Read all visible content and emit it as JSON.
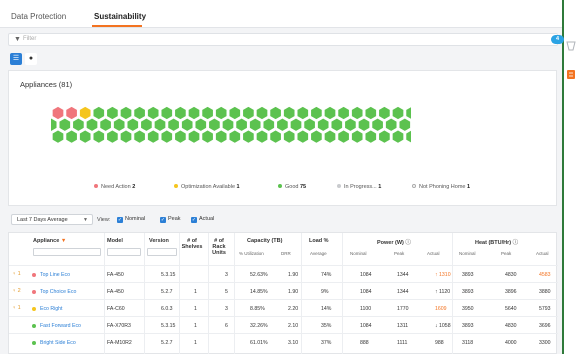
{
  "tabs": [
    {
      "label": "Data Protection",
      "active": false
    },
    {
      "label": "Sustainability",
      "active": true
    }
  ],
  "filter": {
    "placeholder": "Filter",
    "badge": "4"
  },
  "appliances": {
    "title": "Appliances (81)",
    "hex_rows": [
      "RRYGGGGGGGGGGGGGGGGGGGGGGGGGGG",
      "GGGGGGGGGGGGGGGGGGGGGGGGGGGGGGG",
      "GGGGGGGGGGGGGGGGGGGGGGGGGGGGGGX"
    ],
    "status_colors": {
      "R": "#f0767c",
      "Y": "#f5c51e",
      "G": "#5cc24f",
      "P": "#c9cbce",
      "X": "#ffffff"
    },
    "legend": [
      {
        "label": "Need Action",
        "count": "2",
        "color": "#f0767c"
      },
      {
        "label": "Optimization Available",
        "count": "1",
        "color": "#f5c51e"
      },
      {
        "label": "Good",
        "count": "75",
        "color": "#5cc24f"
      },
      {
        "label": "In Progress...",
        "count": "1",
        "color": "#c9cbce"
      },
      {
        "label": "Not Phoning Home",
        "count": "1",
        "color": "#ffffff"
      }
    ]
  },
  "controls": {
    "range": "Last 7 Days Average",
    "view_label": "View:",
    "checks": [
      "Nominal",
      "Peak",
      "Actual"
    ]
  },
  "table": {
    "headers": {
      "appliance": "Appliance",
      "model": "Model",
      "version": "Version",
      "shelves": "# of Shelves",
      "rack_units": "# of Rack Units",
      "capacity": "Capacity (TB)",
      "load": "Load %",
      "power": "Power (W)",
      "heat": "Heat (BTU/Hr)"
    },
    "subheaders": {
      "utilization": "% Utilization",
      "drr": "DRR",
      "average": "Average",
      "p_nominal": "Nominal",
      "p_peak": "Peak",
      "p_actual": "Actual",
      "h_nominal": "Nominal",
      "h_peak": "Peak",
      "h_actual": "Actual"
    },
    "rows": [
      {
        "alert": "1",
        "status": "#f0767c",
        "name": "Top Line Eco",
        "model": "FA-450",
        "version": "5.3.15",
        "shelves": "",
        "units": "3",
        "util": "52.63%",
        "drr": "1.90",
        "load": "74%",
        "pn": "1084",
        "pp": "1344",
        "pa": "1310",
        "pa_dir": "up-warn",
        "hn": "3893",
        "hp": "4830",
        "ha": "4583",
        "ha_warn": true
      },
      {
        "alert": "2",
        "status": "#f0767c",
        "name": "Top Choice Eco",
        "model": "FA-450",
        "version": "5.2.7",
        "shelves": "1",
        "units": "5",
        "util": "14.85%",
        "drr": "1.90",
        "load": "9%",
        "pn": "1084",
        "pp": "1344",
        "pa": "1120",
        "pa_dir": "up",
        "hn": "3893",
        "hp": "3896",
        "ha": "3880",
        "ha_warn": false
      },
      {
        "alert": "1",
        "status": "#f5c51e",
        "name": "Eco Right",
        "model": "FA-C60",
        "version": "6.0.3",
        "shelves": "1",
        "units": "3",
        "util": "8.85%",
        "drr": "2.20",
        "load": "14%",
        "pn": "1100",
        "pp": "1770",
        "pa": "1609",
        "pa_dir": "warn",
        "hn": "3950",
        "hp": "5640",
        "ha": "5793",
        "ha_warn": false
      },
      {
        "alert": "",
        "status": "#5cc24f",
        "name": "Fast Forward Eco",
        "model": "FA-X70R3",
        "version": "5.3.15",
        "shelves": "1",
        "units": "6",
        "util": "32.26%",
        "drr": "2.10",
        "load": "35%",
        "pn": "1084",
        "pp": "1311",
        "pa": "1058",
        "pa_dir": "down",
        "hn": "3893",
        "hp": "4830",
        "ha": "3696",
        "ha_warn": false
      },
      {
        "alert": "",
        "status": "#5cc24f",
        "name": "Bright Side Eco",
        "model": "FA-M10R2",
        "version": "5.2.7",
        "shelves": "1",
        "units": "",
        "util": "61.01%",
        "drr": "3.10",
        "load": "37%",
        "pn": "888",
        "pp": "1111",
        "pa": "988",
        "pa_dir": "",
        "hn": "3118",
        "hp": "4000",
        "ha": "3300",
        "ha_warn": false
      }
    ]
  }
}
